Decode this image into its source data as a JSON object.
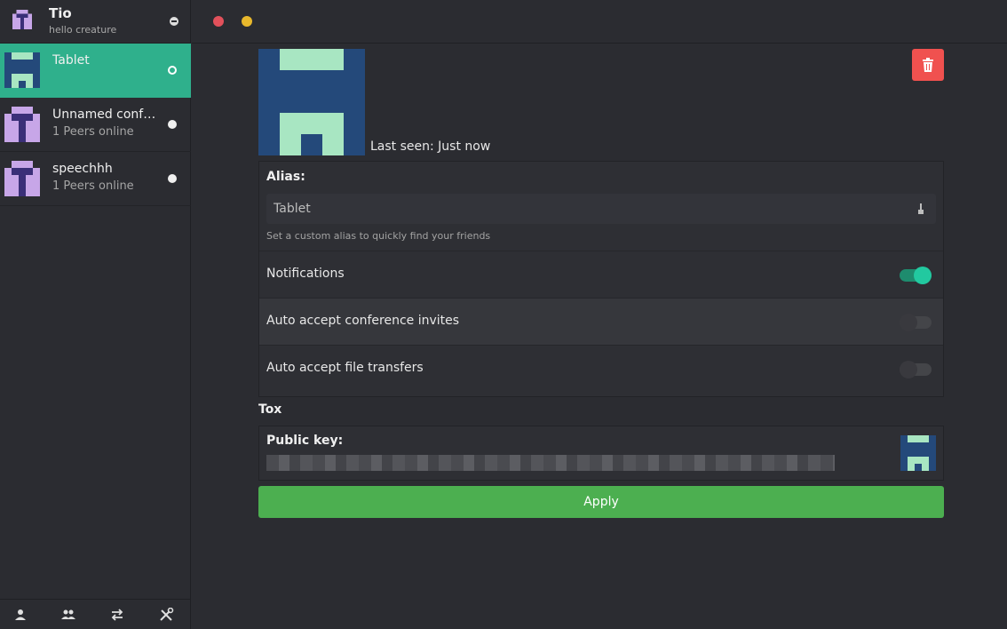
{
  "self": {
    "name": "Tio",
    "status_message": "hello creature"
  },
  "contacts": [
    {
      "name": "Tablet",
      "subtitle": "",
      "active": true
    },
    {
      "name": "Unnamed confe…",
      "subtitle": "1 Peers online",
      "active": false
    },
    {
      "name": "speechhh",
      "subtitle": "1 Peers online",
      "active": false
    }
  ],
  "bottom_bar": {
    "icons": [
      "friends-icon",
      "groups-icon",
      "transfers-icon",
      "settings-icon"
    ]
  },
  "detail": {
    "last_seen": "Last seen: Just now",
    "alias_label": "Alias:",
    "alias_value": "Tablet",
    "alias_hint": "Set a custom alias to quickly find your friends",
    "settings": [
      {
        "label": "Notifications",
        "enabled": true
      },
      {
        "label": "Auto accept conference invites",
        "enabled": false
      },
      {
        "label": "Auto accept file transfers",
        "enabled": false
      }
    ],
    "tox_label": "Tox",
    "public_key_label": "Public key:",
    "apply_label": "Apply"
  },
  "colors": {
    "accent": "#2fb08c",
    "apply": "#4caf50",
    "delete": "#f0514f",
    "close": "#e2515b",
    "minimize": "#e8b82c"
  }
}
